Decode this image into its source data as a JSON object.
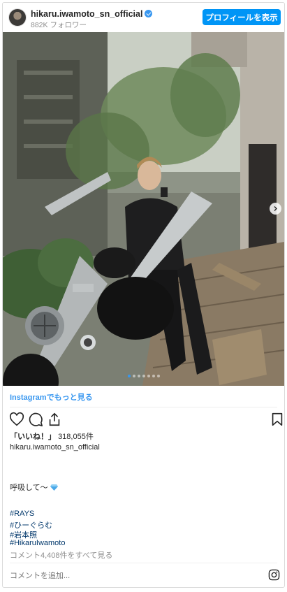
{
  "header": {
    "username": "hikaru.iwamoto_sn_official",
    "followers": "882K フォロワー",
    "profile_button": "プロフィールを表示"
  },
  "carousel": {
    "slide_count": 7,
    "active_index": 0
  },
  "more_link": "Instagramでもっと見る",
  "likes": {
    "label": "「いいね！」",
    "count": "318,055件"
  },
  "caption": {
    "username": "hikaru.iwamoto_sn_official",
    "text": "呼吸して〜",
    "hashtags": [
      "#RAYS",
      "#ひーぐらむ",
      "#岩本照",
      "#HikaruIwamoto"
    ]
  },
  "view_comments": "コメント4,408件をすべて見る",
  "comment_placeholder": "コメントを追加...",
  "icons": {
    "like": "heart-icon",
    "comment": "comment-icon",
    "share": "share-icon",
    "save": "bookmark-icon",
    "instagram": "instagram-icon",
    "next": "chevron-right-icon",
    "verified": "verified-badge-icon"
  },
  "colors": {
    "accent": "#0095f6",
    "link": "#3897f0",
    "hashtag": "#00376b",
    "muted": "#8e8e8e"
  }
}
